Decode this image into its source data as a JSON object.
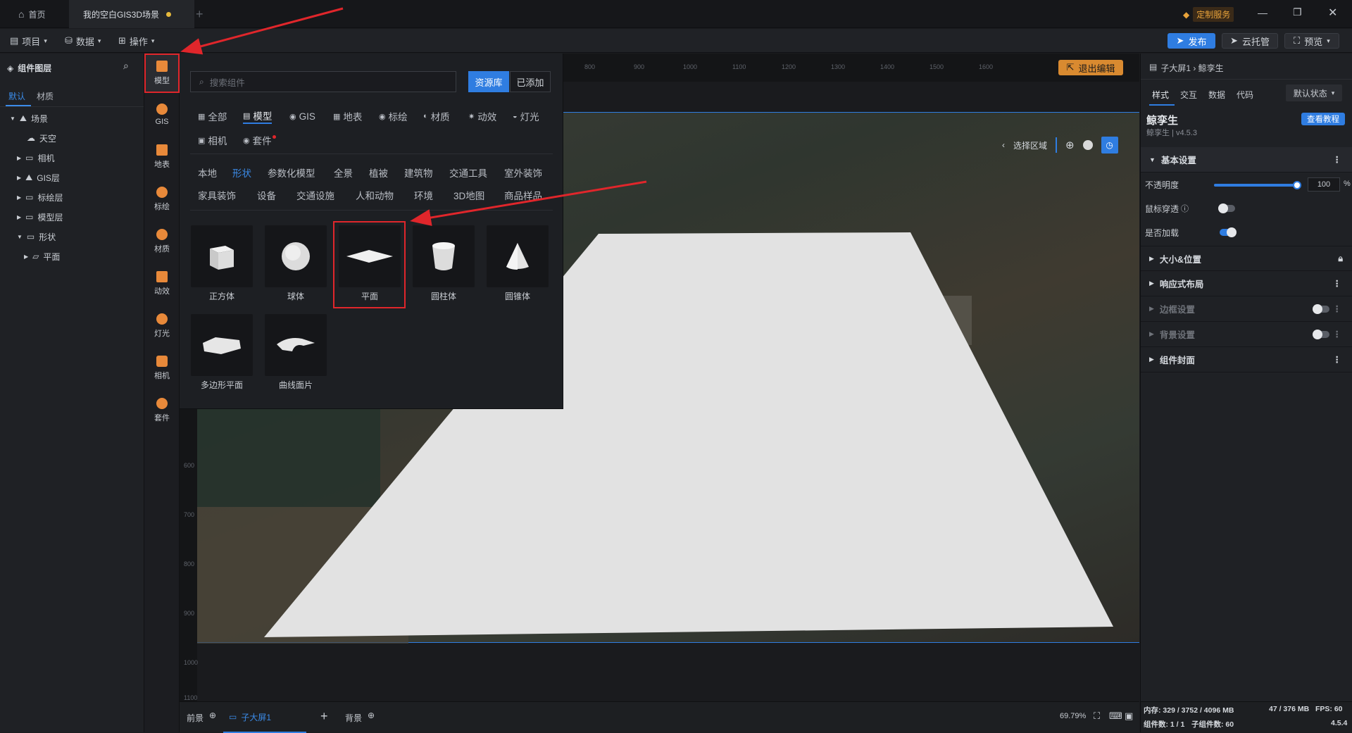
{
  "tabs": [
    {
      "label": "首页"
    },
    {
      "label": "我的空白GIS3D场景"
    }
  ],
  "title_right": {
    "custom_service": "定制服务"
  },
  "menus": [
    {
      "label": "项目"
    },
    {
      "label": "数据"
    },
    {
      "label": "操作"
    }
  ],
  "toolbar": {
    "publish": "发布",
    "cloud": "云托管",
    "preview": "预览"
  },
  "layers": {
    "title": "组件图层",
    "tabs": [
      "默认",
      "材质"
    ],
    "tree": [
      {
        "label": "场景"
      },
      {
        "label": "天空"
      },
      {
        "label": "相机"
      },
      {
        "label": "GIS层"
      },
      {
        "label": "标绘层"
      },
      {
        "label": "模型层"
      },
      {
        "label": "形状"
      },
      {
        "label": "平面"
      }
    ]
  },
  "iconbar": [
    {
      "label": "模型",
      "icon": "model-icon"
    },
    {
      "label": "GIS",
      "icon": "gis-icon"
    },
    {
      "label": "地表",
      "icon": "terrain-icon"
    },
    {
      "label": "标绘",
      "icon": "marker-icon"
    },
    {
      "label": "材质",
      "icon": "material-icon"
    },
    {
      "label": "动效",
      "icon": "effect-icon"
    },
    {
      "label": "灯光",
      "icon": "light-icon"
    },
    {
      "label": "相机",
      "icon": "camera-icon"
    },
    {
      "label": "套件",
      "icon": "kit-icon"
    }
  ],
  "popup": {
    "search_placeholder": "搜索组件",
    "btn_library": "资源库",
    "btn_added": "已添加",
    "categories": [
      "全部",
      "模型",
      "GIS",
      "地表",
      "标绘",
      "材质",
      "动效",
      "灯光",
      "相机",
      "套件"
    ],
    "subcats": [
      "本地",
      "形状",
      "参数化模型",
      "全景",
      "植被",
      "建筑物",
      "交通工具",
      "室外装饰",
      "家具装饰",
      "设备",
      "交通设施",
      "人和动物",
      "环境",
      "3D地图",
      "商品样品"
    ],
    "items": [
      "正方体",
      "球体",
      "平面",
      "圆柱体",
      "圆锥体",
      "多边形平面",
      "曲线面片"
    ]
  },
  "canvas": {
    "exit_edit": "退出编辑",
    "select_area": "选择区域",
    "ruler_top": [
      "800",
      "900",
      "1000",
      "1100",
      "1200",
      "1300",
      "1400",
      "1500",
      "1600"
    ],
    "ruler_left": [
      "600",
      "700",
      "800",
      "900",
      "1000",
      "1100"
    ]
  },
  "bottom": {
    "front": "前景",
    "screen": "子大屏1",
    "back": "背景",
    "zoom": "69.79%"
  },
  "right": {
    "breadcrumb": "子大屏1 › 鲸孪生",
    "tabs": [
      "样式",
      "交互",
      "数据",
      "代码"
    ],
    "state": "默认状态",
    "comp_name": "鲸孪生",
    "comp_version": "鲸孪生 | v4.5.3",
    "tutorial": "查看教程",
    "sec_basic": "基本设置",
    "opacity_label": "不透明度",
    "opacity_value": "100",
    "opacity_unit": "%",
    "opacity_level": 1.0,
    "mouse_label": "鼠标穿透",
    "load_label": "是否加载",
    "sections": [
      "大小&位置",
      "响应式布局",
      "边框设置",
      "背景设置",
      "组件封面"
    ]
  },
  "status": {
    "memory": "内存: 329 / 3752 / 4096 MB",
    "mem2": "47 / 376 MB",
    "fps": "FPS: 60",
    "comp_count": "组件数: 1 / 1",
    "sub_count": "子组件数: 60",
    "version": "4.5.4"
  },
  "colors": {
    "accent": "#2f7de1",
    "orange": "#e8893a",
    "highlight_red": "#e0262b"
  }
}
